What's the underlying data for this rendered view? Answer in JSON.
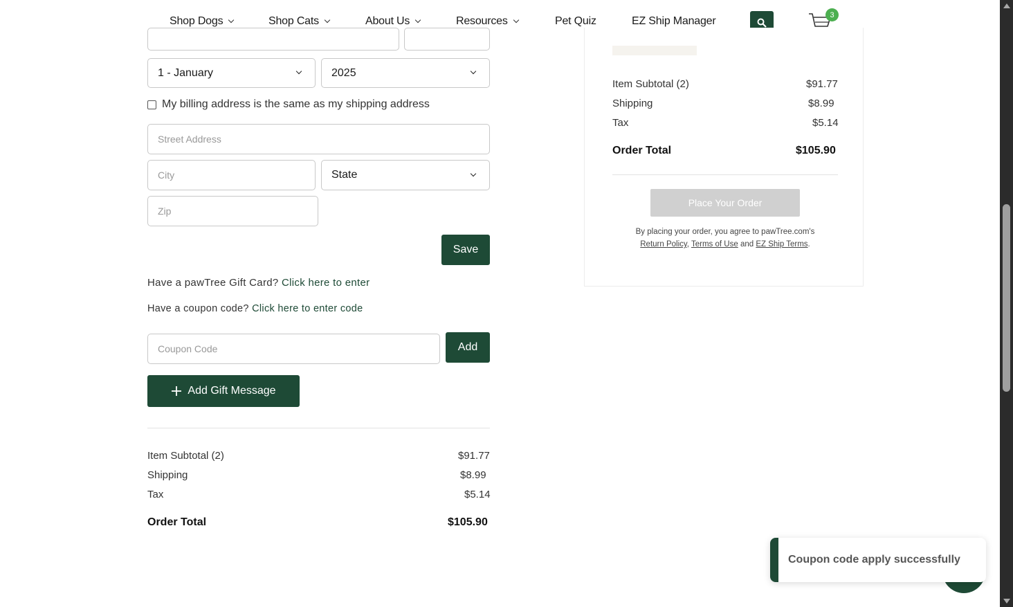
{
  "nav": {
    "items": [
      {
        "label": "Shop Dogs",
        "dropdown": true
      },
      {
        "label": "Shop Cats",
        "dropdown": true
      },
      {
        "label": "About Us",
        "dropdown": true
      },
      {
        "label": "Resources",
        "dropdown": true
      },
      {
        "label": "Pet Quiz",
        "dropdown": false
      },
      {
        "label": "EZ Ship Manager",
        "dropdown": false
      }
    ],
    "cart_count": "3",
    "search_icon": "search-icon",
    "cart_icon": "cart-icon"
  },
  "payment": {
    "exp_month": "1 - January",
    "exp_year": "2025"
  },
  "billing": {
    "same_as_shipping_label": "My billing address is the same as my shipping address",
    "same_as_shipping_checked": false,
    "street_placeholder": "Street Address",
    "city_placeholder": "City",
    "state_value": "State",
    "zip_placeholder": "Zip",
    "save_label": "Save"
  },
  "gift_card": {
    "prompt": "Have a pawTree Gift Card?",
    "link": "Click here to enter"
  },
  "coupon": {
    "prompt": "Have a coupon code?",
    "link": "Click here to enter code",
    "placeholder": "Coupon Code",
    "add_label": "Add"
  },
  "gift_message": {
    "label": "Add Gift Message"
  },
  "summary": {
    "subtotal_label": "Item Subtotal (2)",
    "subtotal_value": "$91.77",
    "shipping_label": "Shipping",
    "shipping_value": "$8.99",
    "tax_label": "Tax",
    "tax_value": "$5.14",
    "total_label": "Order Total",
    "total_value": "$105.90"
  },
  "order_panel": {
    "place_order_label": "Place Your Order",
    "legal_prefix": "By placing your order, you agree to pawTree.com's",
    "return_policy": "Return Policy",
    "comma": ",",
    "terms_of_use": "Terms of Use",
    "and": "and",
    "ez_ship_terms": "EZ Ship Terms",
    "period": "."
  },
  "toast": {
    "message": "Coupon code apply successfully"
  },
  "colors": {
    "brand_green": "#1e4a36",
    "badge_green": "#4caf50",
    "disabled_gray": "#d0d0d0"
  }
}
